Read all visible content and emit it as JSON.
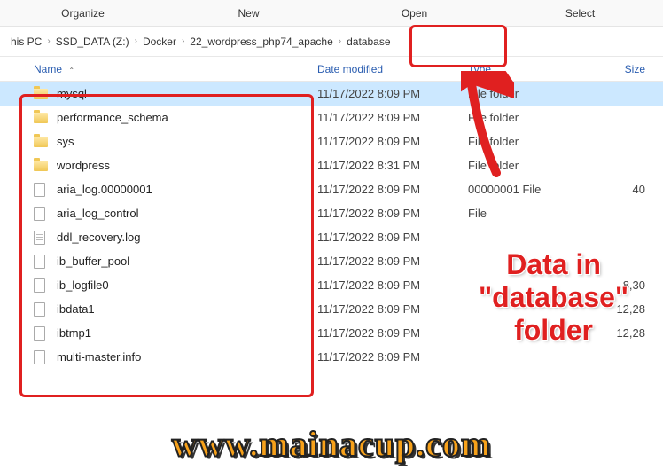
{
  "toolbar": {
    "organize": "Organize",
    "new": "New",
    "open": "Open",
    "select": "Select"
  },
  "breadcrumb": {
    "items": [
      "his PC",
      "SSD_DATA (Z:)",
      "Docker",
      "22_wordpress_php74_apache",
      "database"
    ]
  },
  "columns": {
    "name": "Name",
    "date": "Date modified",
    "type": "Type",
    "size": "Size"
  },
  "files": [
    {
      "name": "mysql",
      "date": "11/17/2022 8:09 PM",
      "type": "File folder",
      "size": "",
      "icon": "folder",
      "selected": true
    },
    {
      "name": "performance_schema",
      "date": "11/17/2022 8:09 PM",
      "type": "File folder",
      "size": "",
      "icon": "folder"
    },
    {
      "name": "sys",
      "date": "11/17/2022 8:09 PM",
      "type": "File folder",
      "size": "",
      "icon": "folder"
    },
    {
      "name": "wordpress",
      "date": "11/17/2022 8:31 PM",
      "type": "File folder",
      "size": "",
      "icon": "folder"
    },
    {
      "name": "aria_log.00000001",
      "date": "11/17/2022 8:09 PM",
      "type": "00000001 File",
      "size": "40",
      "icon": "file"
    },
    {
      "name": "aria_log_control",
      "date": "11/17/2022 8:09 PM",
      "type": "File",
      "size": "",
      "icon": "file"
    },
    {
      "name": "ddl_recovery.log",
      "date": "11/17/2022 8:09 PM",
      "type": "",
      "size": "",
      "icon": "file-lines"
    },
    {
      "name": "ib_buffer_pool",
      "date": "11/17/2022 8:09 PM",
      "type": "",
      "size": "",
      "icon": "file"
    },
    {
      "name": "ib_logfile0",
      "date": "11/17/2022 8:09 PM",
      "type": "",
      "size": "8,30",
      "icon": "file"
    },
    {
      "name": "ibdata1",
      "date": "11/17/2022 8:09 PM",
      "type": "",
      "size": "12,28",
      "icon": "file"
    },
    {
      "name": "ibtmp1",
      "date": "11/17/2022 8:09 PM",
      "type": "",
      "size": "12,28",
      "icon": "file"
    },
    {
      "name": "multi-master.info",
      "date": "11/17/2022 8:09 PM",
      "type": "",
      "size": "",
      "icon": "file"
    }
  ],
  "annotation": {
    "callout_line1": "Data in",
    "callout_line2": "\"database\"",
    "callout_line3": "folder",
    "watermark": "www.mainacup.com"
  }
}
